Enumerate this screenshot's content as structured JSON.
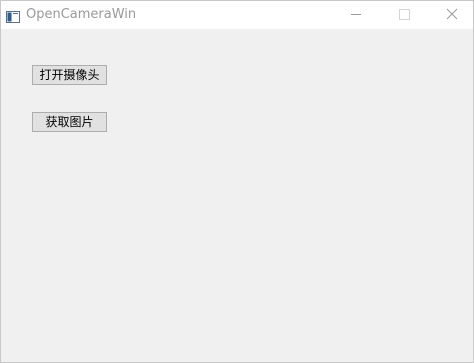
{
  "window": {
    "title": "OpenCameraWin"
  },
  "icons": {
    "app": "app-window-icon",
    "minimize": "minimize-icon",
    "maximize": "maximize-icon",
    "close": "close-icon"
  },
  "buttons": {
    "open_camera_label": "打开摄像头",
    "get_image_label": "获取图片"
  },
  "colors": {
    "client_bg": "#f0f0f0",
    "button_bg": "#e1e1e1",
    "button_border": "#adadad",
    "title_text": "#999999"
  }
}
